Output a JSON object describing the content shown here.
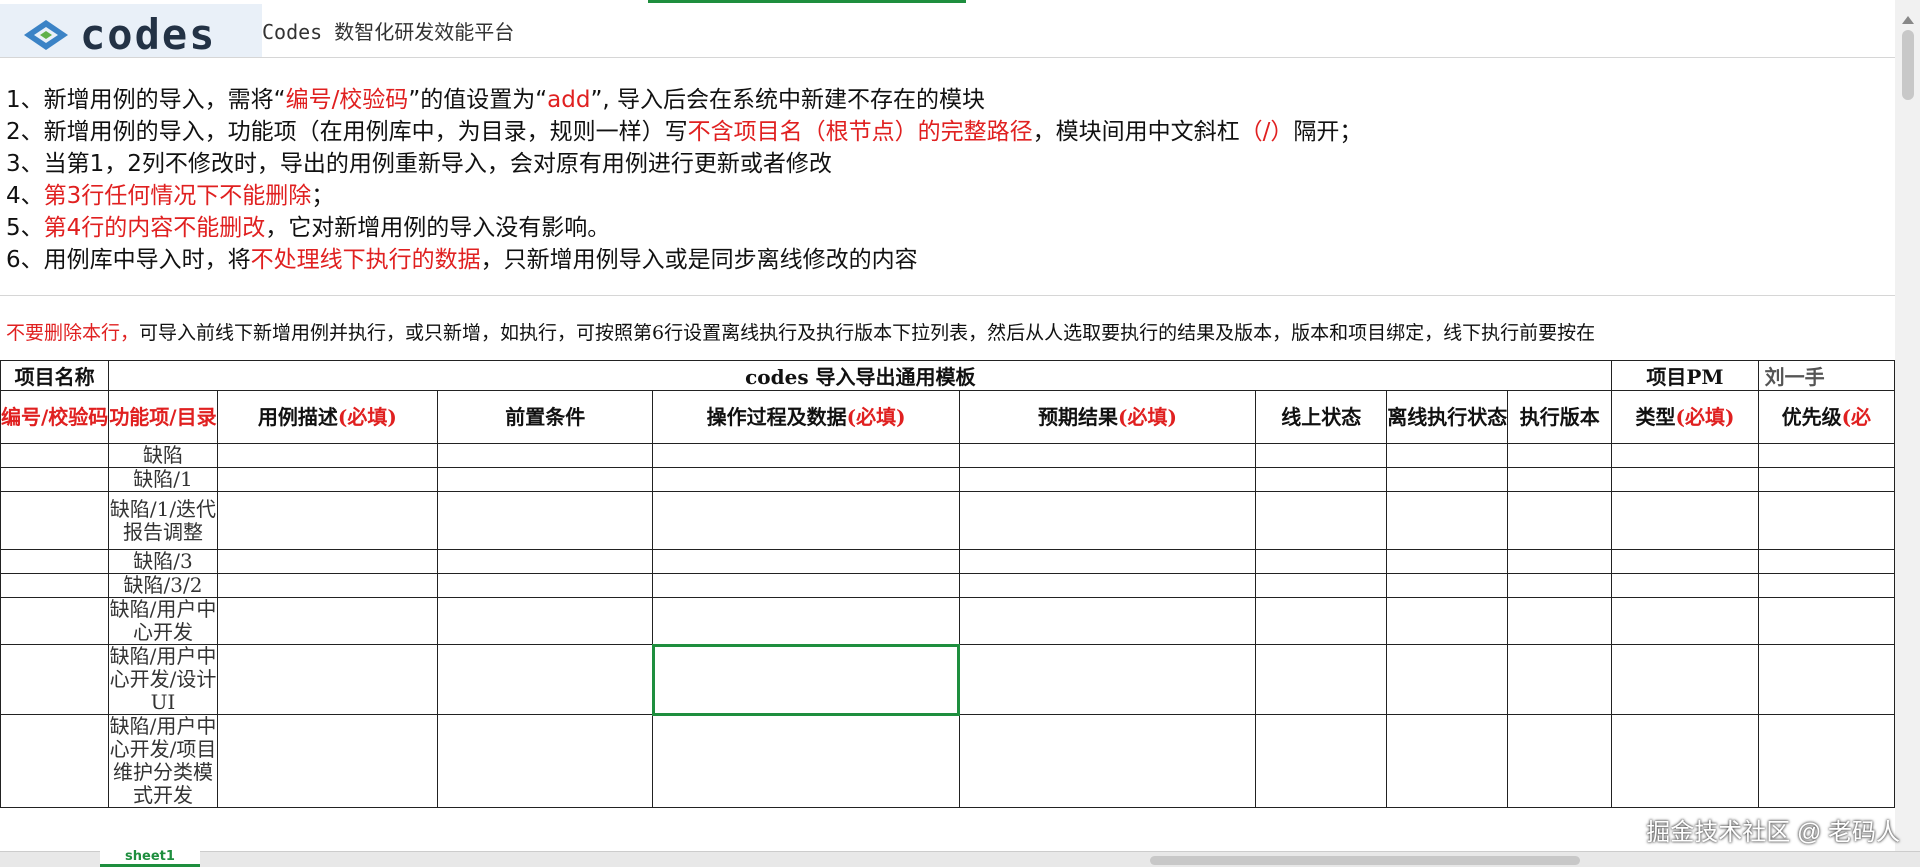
{
  "header": {
    "logo_text": "codes",
    "platform_name": "Codes 数智化研发效能平台"
  },
  "notes": [
    {
      "segments": [
        {
          "t": "1、新增用例的导入，需将“",
          "hl": false
        },
        {
          "t": "编号/校验码",
          "hl": true
        },
        {
          "t": "”的值设置为“",
          "hl": false
        },
        {
          "t": "add",
          "hl": true
        },
        {
          "t": "”, 导入后会在系统中新建不存在的模块",
          "hl": false
        }
      ]
    },
    {
      "segments": [
        {
          "t": "2、新增用例的导入，功能项（在用例库中，为目录，规则一样）写",
          "hl": false
        },
        {
          "t": "不含项目名（根节点）的完整路径",
          "hl": true
        },
        {
          "t": "，模块间用中文斜杠",
          "hl": false
        },
        {
          "t": "（/）",
          "hl": true
        },
        {
          "t": "隔开；",
          "hl": false
        }
      ]
    },
    {
      "segments": [
        {
          "t": "3、当第1，2列不修改时，导出的用例重新导入，会对原有用例进行更新或者修改",
          "hl": false
        }
      ]
    },
    {
      "segments": [
        {
          "t": "4、",
          "hl": false
        },
        {
          "t": "第3行任何情况下不能删除",
          "hl": true
        },
        {
          "t": "；",
          "hl": false
        }
      ]
    },
    {
      "segments": [
        {
          "t": "5、",
          "hl": false
        },
        {
          "t": "第4行的内容不能删改",
          "hl": true
        },
        {
          "t": "，它对新增用例的导入没有影响。",
          "hl": false
        }
      ]
    },
    {
      "segments": [
        {
          "t": "6、用例库中导入时，将",
          "hl": false
        },
        {
          "t": "不处理线下执行的数据",
          "hl": true
        },
        {
          "t": "，只新增用例导入或是同步离线修改的内容",
          "hl": false
        }
      ]
    }
  ],
  "notice": {
    "red": "不要删除本行，",
    "text": "可导入前线下新增用例并执行，或只新增，如执行，可按照第6行设置离线执行及执行版本下拉列表，然后从人选取要执行的结果及版本，版本和项目绑定，线下执行前要按在"
  },
  "table": {
    "row1": {
      "project_name_label": "项目名称",
      "template_title": "codes 导入导出通用模板",
      "pm_label": "项目PM",
      "pm_value": "刘一手"
    },
    "headers": [
      {
        "text": "编号/校验码",
        "red": "",
        "all_red": true
      },
      {
        "text": "功能项/目录",
        "red": "",
        "all_red": true
      },
      {
        "text": "用例描述",
        "red": "(必填)",
        "all_red": false
      },
      {
        "text": "前置条件",
        "red": "",
        "all_red": false
      },
      {
        "text": "操作过程及数据",
        "red": "(必填)",
        "all_red": false
      },
      {
        "text": "预期结果",
        "red": "(必填)",
        "all_red": false
      },
      {
        "text": "线上状态",
        "red": "",
        "all_red": false
      },
      {
        "text": "离线执行状态",
        "red": "",
        "all_red": false
      },
      {
        "text": "执行版本",
        "red": "",
        "all_red": false
      },
      {
        "text": "类型",
        "red": "(必填)",
        "all_red": false
      },
      {
        "text": "优先级",
        "red": "(必",
        "all_red": false
      }
    ],
    "rows": [
      {
        "func": "缺陷"
      },
      {
        "func": "缺陷/1"
      },
      {
        "func": "缺陷/1/迭代报告调整"
      },
      {
        "func": "缺陷/3"
      },
      {
        "func": "缺陷/3/2"
      },
      {
        "func": "缺陷/用户中心开发"
      },
      {
        "func": "缺陷/用户中心开发/设计UI"
      },
      {
        "func": "缺陷/用户中心开发/项目维护分类模式开发"
      }
    ]
  },
  "bottom": {
    "sheet_tab": "sheet1"
  },
  "watermark": "掘金技术社区 @ 老码人",
  "colors": {
    "highlight_red": "#e02020",
    "selection_green": "#1e8e3e",
    "logo_bg": "#e9f0f8"
  }
}
